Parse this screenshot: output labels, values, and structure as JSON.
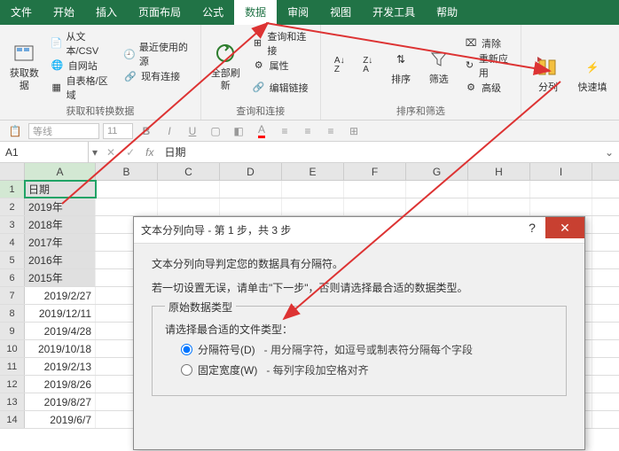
{
  "menu": {
    "file": "文件",
    "home": "开始",
    "insert": "插入",
    "layout": "页面布局",
    "formula": "公式",
    "data": "数据",
    "review": "审阅",
    "view": "视图",
    "dev": "开发工具",
    "help": "帮助"
  },
  "ribbon": {
    "get_data": "获取数\n据",
    "from_csv": "从文本/CSV",
    "from_web": "自网站",
    "from_table": "自表格/区域",
    "recent": "最近使用的源",
    "existing": "现有连接",
    "group1": "获取和转换数据",
    "refresh_all": "全部刷新",
    "queries": "查询和连接",
    "props": "属性",
    "edit_links": "编辑链接",
    "group2": "查询和连接",
    "sort": "排序",
    "filter": "筛选",
    "clear": "清除",
    "reapply": "重新应用",
    "advanced": "高级",
    "group3": "排序和筛选",
    "text_cols": "分列",
    "fast": "快速填"
  },
  "fmt": {
    "font": "等线",
    "size": "11"
  },
  "namebox": "A1",
  "fx_value": "日期",
  "cols": [
    "A",
    "B",
    "C",
    "D",
    "E",
    "F",
    "G",
    "H",
    "I"
  ],
  "rows": [
    {
      "n": 1,
      "a": "日期",
      "cls": "hdr"
    },
    {
      "n": 2,
      "a": "2019年",
      "cls": "yr"
    },
    {
      "n": 3,
      "a": "2018年",
      "cls": "yr"
    },
    {
      "n": 4,
      "a": "2017年",
      "cls": "yr"
    },
    {
      "n": 5,
      "a": "2016年",
      "cls": "yr"
    },
    {
      "n": 6,
      "a": "2015年",
      "cls": "yr"
    },
    {
      "n": 7,
      "a": "2019/2/27",
      "cls": "dt"
    },
    {
      "n": 8,
      "a": "2019/12/11",
      "cls": "dt"
    },
    {
      "n": 9,
      "a": "2019/4/28",
      "cls": "dt"
    },
    {
      "n": 10,
      "a": "2019/10/18",
      "cls": "dt"
    },
    {
      "n": 11,
      "a": "2019/2/13",
      "cls": "dt"
    },
    {
      "n": 12,
      "a": "2019/8/26",
      "cls": "dt"
    },
    {
      "n": 13,
      "a": "2019/8/27",
      "cls": "dt"
    },
    {
      "n": 14,
      "a": "2019/6/7",
      "cls": "dt"
    }
  ],
  "dialog": {
    "title": "文本分列向导 - 第 1 步，共 3 步",
    "line1": "文本分列向导判定您的数据具有分隔符。",
    "line2": "若一切设置无误，请单击\"下一步\"，否则请选择最合适的数据类型。",
    "legend": "原始数据类型",
    "choose": "请选择最合适的文件类型：",
    "opt1": "分隔符号(D)",
    "opt1_desc": "- 用分隔字符，如逗号或制表符分隔每个字段",
    "opt2": "固定宽度(W)",
    "opt2_desc": "- 每列字段加空格对齐"
  }
}
